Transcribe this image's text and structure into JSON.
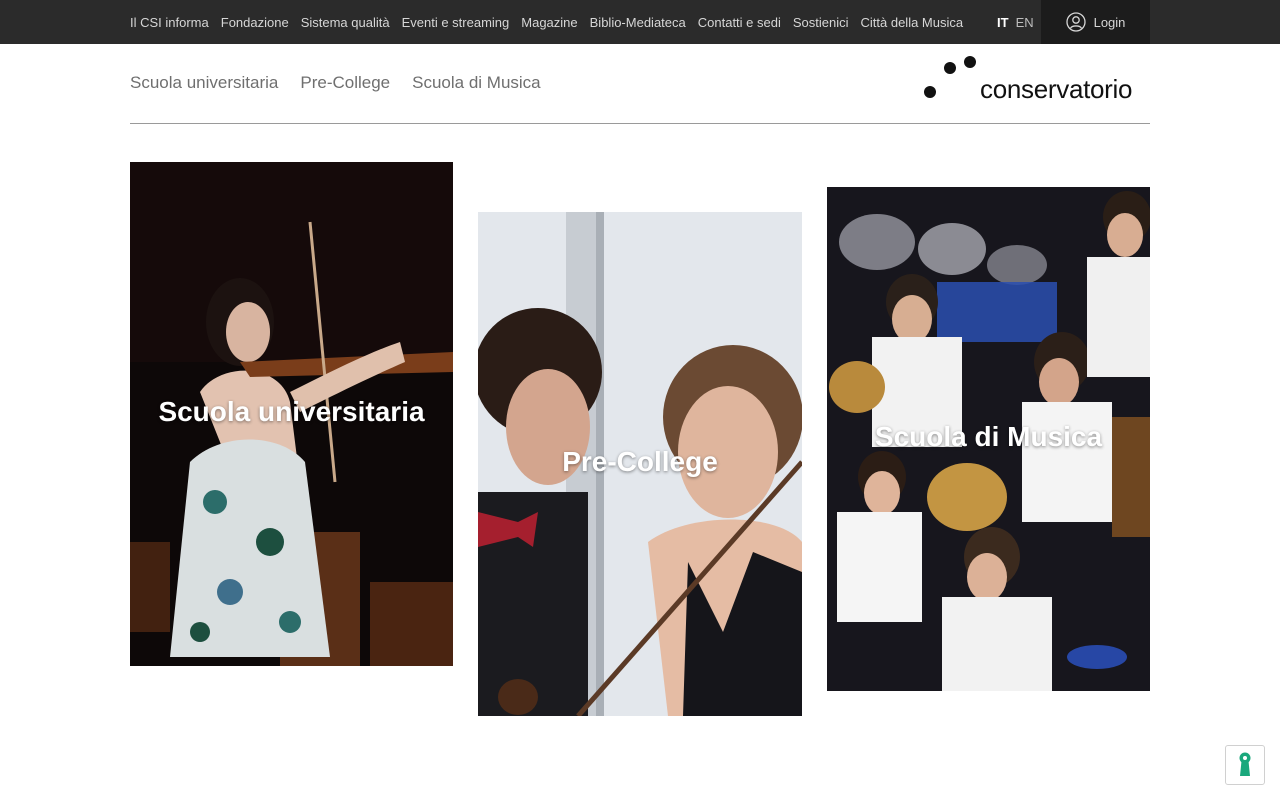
{
  "topbar": {
    "links": [
      "Il CSI informa",
      "Fondazione",
      "Sistema qualità",
      "Eventi e streaming",
      "Magazine",
      "Biblio-Mediateca",
      "Contatti e sedi",
      "Sostienici",
      "Città della Musica"
    ],
    "lang_it": "IT",
    "lang_en": "EN",
    "login_label": "Login"
  },
  "nav": {
    "links": [
      "Scuola universitaria",
      "Pre-College",
      "Scuola di Musica"
    ]
  },
  "logo": {
    "text": "conservatorio"
  },
  "cards": [
    {
      "label": "Scuola universitaria"
    },
    {
      "label": "Pre-College"
    },
    {
      "label": "Scuola di Musica"
    }
  ],
  "icons": {
    "login": "user-circle-icon",
    "cookie": "keyhole-icon"
  },
  "colors": {
    "topbar_bg": "#2b2b2b",
    "login_bg": "#1c1c1c",
    "cookie_accent": "#1aa87c"
  }
}
